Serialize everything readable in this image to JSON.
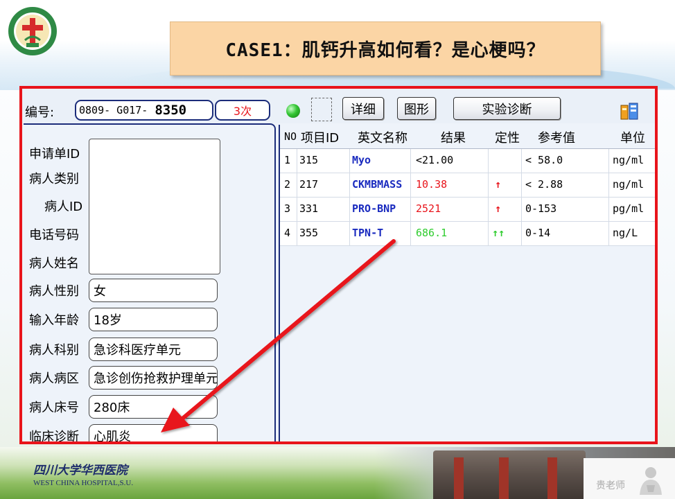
{
  "header": {
    "title": "CASE1：肌钙升高如何看？是心梗吗？"
  },
  "toolbar": {
    "id_label": "编号:",
    "id_prefix": "0809-  G017-",
    "id_number": "8350",
    "count": "3次",
    "detail_button": "详细",
    "graph_button": "图形",
    "diagnosis_button": "实验诊断"
  },
  "patient_form": {
    "fields": [
      {
        "label": "申请单ID",
        "value": ""
      },
      {
        "label": "病人类别",
        "value": ""
      },
      {
        "label": "病人ID",
        "value": ""
      },
      {
        "label": "电话号码",
        "value": ""
      },
      {
        "label": "病人姓名",
        "value": ""
      },
      {
        "label": "病人性别",
        "value": "女"
      },
      {
        "label": "输入年龄",
        "value": "18岁"
      },
      {
        "label": "病人科别",
        "value": "急诊科医疗单元"
      },
      {
        "label": "病人病区",
        "value": "急诊创伤抢救护理单元"
      },
      {
        "label": "病人床号",
        "value": "280床"
      },
      {
        "label": "临床诊断",
        "value": "心肌炎"
      }
    ]
  },
  "results_table": {
    "columns": [
      "NO",
      "项目ID",
      "英文名称",
      "结果",
      "定性",
      "参考值",
      "单位"
    ],
    "rows": [
      {
        "no": "1",
        "item_id": "315",
        "name": "Myo",
        "result": "<21.00",
        "flag": "",
        "reference": "< 58.0",
        "unit": "ng/ml",
        "result_color": "#000000"
      },
      {
        "no": "2",
        "item_id": "217",
        "name": "CKMBMASS",
        "result": "10.38",
        "flag": "↑",
        "reference": "< 2.88",
        "unit": "ng/ml",
        "result_color": "#e8141b"
      },
      {
        "no": "3",
        "item_id": "331",
        "name": "PRO-BNP",
        "result": "2521",
        "flag": "↑",
        "reference": "0-153",
        "unit": "pg/ml",
        "result_color": "#e8141b"
      },
      {
        "no": "4",
        "item_id": "355",
        "name": "TPN-T",
        "result": "686.1",
        "flag": "↑↑",
        "reference": "0-14",
        "unit": "ng/L",
        "result_color": "#2ecc2e"
      }
    ]
  },
  "footer": {
    "hospital_cn": "四川大学华西医院",
    "hospital_en": "WEST CHINA HOSPITAL,S.U.",
    "teacher_mark": "贵老师"
  },
  "colors": {
    "frame_red": "#e8141b",
    "name_blue": "#1a2bbf",
    "flag_red": "#e8141b",
    "flag_green": "#2ecc2e",
    "title_bg": "#fbd5a5"
  },
  "icons": {
    "logo": "hospital-seal-icon",
    "status": "green-led-icon",
    "tool": "toolbox-icon",
    "annotation": "red-arrow-icon"
  }
}
